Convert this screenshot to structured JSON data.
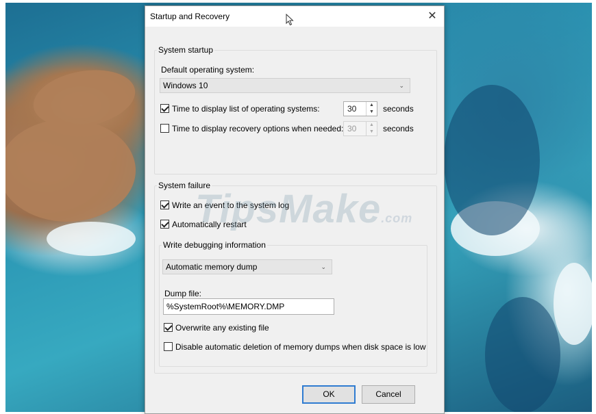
{
  "dialog": {
    "title": "Startup and Recovery",
    "close_glyph": "✕"
  },
  "system_startup": {
    "group_label": "System startup",
    "default_os_label": "Default operating system:",
    "default_os_value": "Windows 10",
    "display_list": {
      "checked": true,
      "label": "Time to display list of operating systems:",
      "value": "30",
      "unit": "seconds"
    },
    "display_recovery": {
      "checked": false,
      "label": "Time to display recovery options when needed:",
      "value": "30",
      "unit": "seconds"
    }
  },
  "system_failure": {
    "group_label": "System failure",
    "write_event": {
      "checked": true,
      "label": "Write an event to the system log"
    },
    "auto_restart": {
      "checked": true,
      "label": "Automatically restart"
    },
    "debugging": {
      "group_label": "Write debugging information",
      "dump_type": "Automatic memory dump",
      "dump_file_label": "Dump file:",
      "dump_file_value": "%SystemRoot%\\MEMORY.DMP",
      "overwrite": {
        "checked": true,
        "label": "Overwrite any existing file"
      },
      "disable_auto_delete": {
        "checked": false,
        "label": "Disable automatic deletion of memory dumps when disk space is low"
      }
    }
  },
  "buttons": {
    "ok": "OK",
    "cancel": "Cancel"
  },
  "watermark": {
    "text": "TipsMake",
    "suffix": ".com"
  },
  "icons": {
    "close": "close-icon",
    "chevron": "chevron-down-icon",
    "spin_up": "spin-up-icon",
    "spin_down": "spin-down-icon",
    "cursor": "mouse-pointer-icon"
  },
  "colors": {
    "dialog_bg": "#f0f0f0",
    "default_button_border": "#2e7bd1"
  }
}
